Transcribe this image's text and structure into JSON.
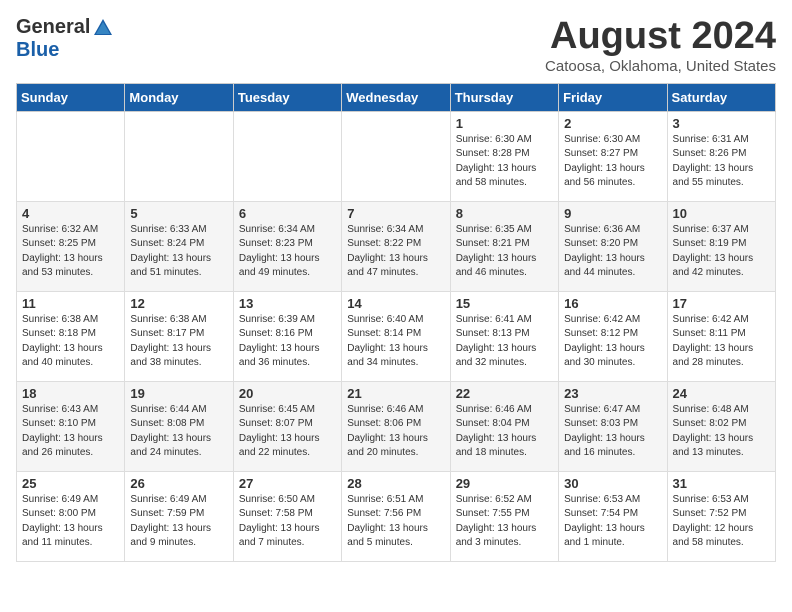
{
  "header": {
    "logo_general": "General",
    "logo_blue": "Blue",
    "month_year": "August 2024",
    "location": "Catoosa, Oklahoma, United States"
  },
  "weekdays": [
    "Sunday",
    "Monday",
    "Tuesday",
    "Wednesday",
    "Thursday",
    "Friday",
    "Saturday"
  ],
  "weeks": [
    [
      {
        "day": "",
        "info": ""
      },
      {
        "day": "",
        "info": ""
      },
      {
        "day": "",
        "info": ""
      },
      {
        "day": "",
        "info": ""
      },
      {
        "day": "1",
        "info": "Sunrise: 6:30 AM\nSunset: 8:28 PM\nDaylight: 13 hours\nand 58 minutes."
      },
      {
        "day": "2",
        "info": "Sunrise: 6:30 AM\nSunset: 8:27 PM\nDaylight: 13 hours\nand 56 minutes."
      },
      {
        "day": "3",
        "info": "Sunrise: 6:31 AM\nSunset: 8:26 PM\nDaylight: 13 hours\nand 55 minutes."
      }
    ],
    [
      {
        "day": "4",
        "info": "Sunrise: 6:32 AM\nSunset: 8:25 PM\nDaylight: 13 hours\nand 53 minutes."
      },
      {
        "day": "5",
        "info": "Sunrise: 6:33 AM\nSunset: 8:24 PM\nDaylight: 13 hours\nand 51 minutes."
      },
      {
        "day": "6",
        "info": "Sunrise: 6:34 AM\nSunset: 8:23 PM\nDaylight: 13 hours\nand 49 minutes."
      },
      {
        "day": "7",
        "info": "Sunrise: 6:34 AM\nSunset: 8:22 PM\nDaylight: 13 hours\nand 47 minutes."
      },
      {
        "day": "8",
        "info": "Sunrise: 6:35 AM\nSunset: 8:21 PM\nDaylight: 13 hours\nand 46 minutes."
      },
      {
        "day": "9",
        "info": "Sunrise: 6:36 AM\nSunset: 8:20 PM\nDaylight: 13 hours\nand 44 minutes."
      },
      {
        "day": "10",
        "info": "Sunrise: 6:37 AM\nSunset: 8:19 PM\nDaylight: 13 hours\nand 42 minutes."
      }
    ],
    [
      {
        "day": "11",
        "info": "Sunrise: 6:38 AM\nSunset: 8:18 PM\nDaylight: 13 hours\nand 40 minutes."
      },
      {
        "day": "12",
        "info": "Sunrise: 6:38 AM\nSunset: 8:17 PM\nDaylight: 13 hours\nand 38 minutes."
      },
      {
        "day": "13",
        "info": "Sunrise: 6:39 AM\nSunset: 8:16 PM\nDaylight: 13 hours\nand 36 minutes."
      },
      {
        "day": "14",
        "info": "Sunrise: 6:40 AM\nSunset: 8:14 PM\nDaylight: 13 hours\nand 34 minutes."
      },
      {
        "day": "15",
        "info": "Sunrise: 6:41 AM\nSunset: 8:13 PM\nDaylight: 13 hours\nand 32 minutes."
      },
      {
        "day": "16",
        "info": "Sunrise: 6:42 AM\nSunset: 8:12 PM\nDaylight: 13 hours\nand 30 minutes."
      },
      {
        "day": "17",
        "info": "Sunrise: 6:42 AM\nSunset: 8:11 PM\nDaylight: 13 hours\nand 28 minutes."
      }
    ],
    [
      {
        "day": "18",
        "info": "Sunrise: 6:43 AM\nSunset: 8:10 PM\nDaylight: 13 hours\nand 26 minutes."
      },
      {
        "day": "19",
        "info": "Sunrise: 6:44 AM\nSunset: 8:08 PM\nDaylight: 13 hours\nand 24 minutes."
      },
      {
        "day": "20",
        "info": "Sunrise: 6:45 AM\nSunset: 8:07 PM\nDaylight: 13 hours\nand 22 minutes."
      },
      {
        "day": "21",
        "info": "Sunrise: 6:46 AM\nSunset: 8:06 PM\nDaylight: 13 hours\nand 20 minutes."
      },
      {
        "day": "22",
        "info": "Sunrise: 6:46 AM\nSunset: 8:04 PM\nDaylight: 13 hours\nand 18 minutes."
      },
      {
        "day": "23",
        "info": "Sunrise: 6:47 AM\nSunset: 8:03 PM\nDaylight: 13 hours\nand 16 minutes."
      },
      {
        "day": "24",
        "info": "Sunrise: 6:48 AM\nSunset: 8:02 PM\nDaylight: 13 hours\nand 13 minutes."
      }
    ],
    [
      {
        "day": "25",
        "info": "Sunrise: 6:49 AM\nSunset: 8:00 PM\nDaylight: 13 hours\nand 11 minutes."
      },
      {
        "day": "26",
        "info": "Sunrise: 6:49 AM\nSunset: 7:59 PM\nDaylight: 13 hours\nand 9 minutes."
      },
      {
        "day": "27",
        "info": "Sunrise: 6:50 AM\nSunset: 7:58 PM\nDaylight: 13 hours\nand 7 minutes."
      },
      {
        "day": "28",
        "info": "Sunrise: 6:51 AM\nSunset: 7:56 PM\nDaylight: 13 hours\nand 5 minutes."
      },
      {
        "day": "29",
        "info": "Sunrise: 6:52 AM\nSunset: 7:55 PM\nDaylight: 13 hours\nand 3 minutes."
      },
      {
        "day": "30",
        "info": "Sunrise: 6:53 AM\nSunset: 7:54 PM\nDaylight: 13 hours\nand 1 minute."
      },
      {
        "day": "31",
        "info": "Sunrise: 6:53 AM\nSunset: 7:52 PM\nDaylight: 12 hours\nand 58 minutes."
      }
    ]
  ]
}
